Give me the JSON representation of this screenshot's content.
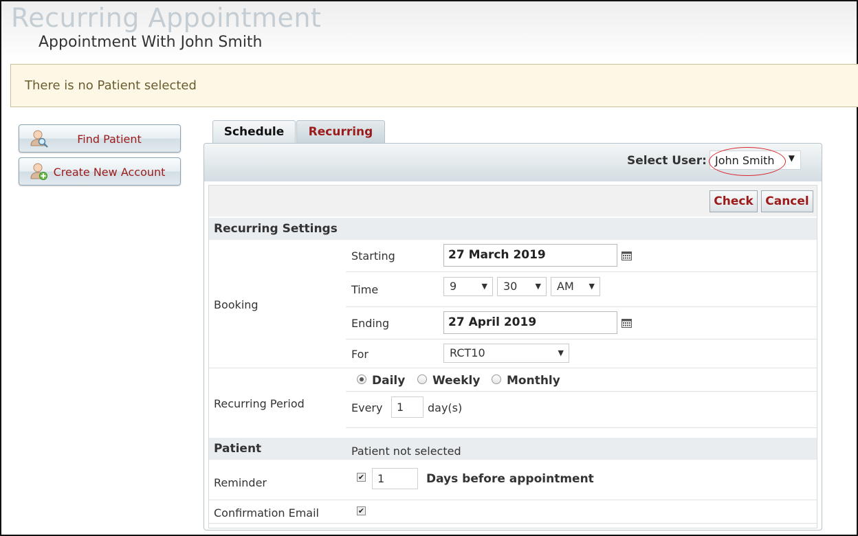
{
  "page": {
    "title": "Recurring Appointment",
    "subtitle": "Appointment With John Smith"
  },
  "notice": {
    "text": "There is no Patient selected"
  },
  "sidebar": {
    "buttons": [
      {
        "label": "Find Patient",
        "icon": "find-user-icon"
      },
      {
        "label": "Create New Account",
        "icon": "add-user-icon"
      }
    ]
  },
  "tabs": [
    {
      "label": "Schedule",
      "active": false
    },
    {
      "label": "Recurring",
      "active": true
    }
  ],
  "header": {
    "select_user_label": "Select User:",
    "selected_user": "John Smith"
  },
  "toolbar": {
    "check_label": "Check",
    "cancel_label": "Cancel"
  },
  "recurring_settings": {
    "section_title": "Recurring Settings",
    "booking_label": "Booking",
    "starting_label": "Starting",
    "starting_value": "27 March 2019",
    "time_label": "Time",
    "time_hour": "9",
    "time_minute": "30",
    "time_ampm": "AM",
    "ending_label": "Ending",
    "ending_value": "27 April 2019",
    "for_label": "For",
    "for_value": "RCT10",
    "period_label": "Recurring Period",
    "period_options": [
      {
        "label": "Daily",
        "selected": true
      },
      {
        "label": "Weekly",
        "selected": false
      },
      {
        "label": "Monthly",
        "selected": false
      }
    ],
    "every_label": "Every",
    "every_value": "1",
    "every_unit": "day(s)"
  },
  "patient": {
    "label": "Patient",
    "value": "Patient not selected",
    "reminder_label": "Reminder",
    "reminder_checked": true,
    "reminder_days": "1",
    "reminder_suffix": "Days before appointment",
    "confirmation_label": "Confirmation Email",
    "confirmation_checked": true
  },
  "colors": {
    "accent_red": "#9b1b1b",
    "notice_bg": "#fdf8e6",
    "highlight_circle": "#d9262c"
  }
}
